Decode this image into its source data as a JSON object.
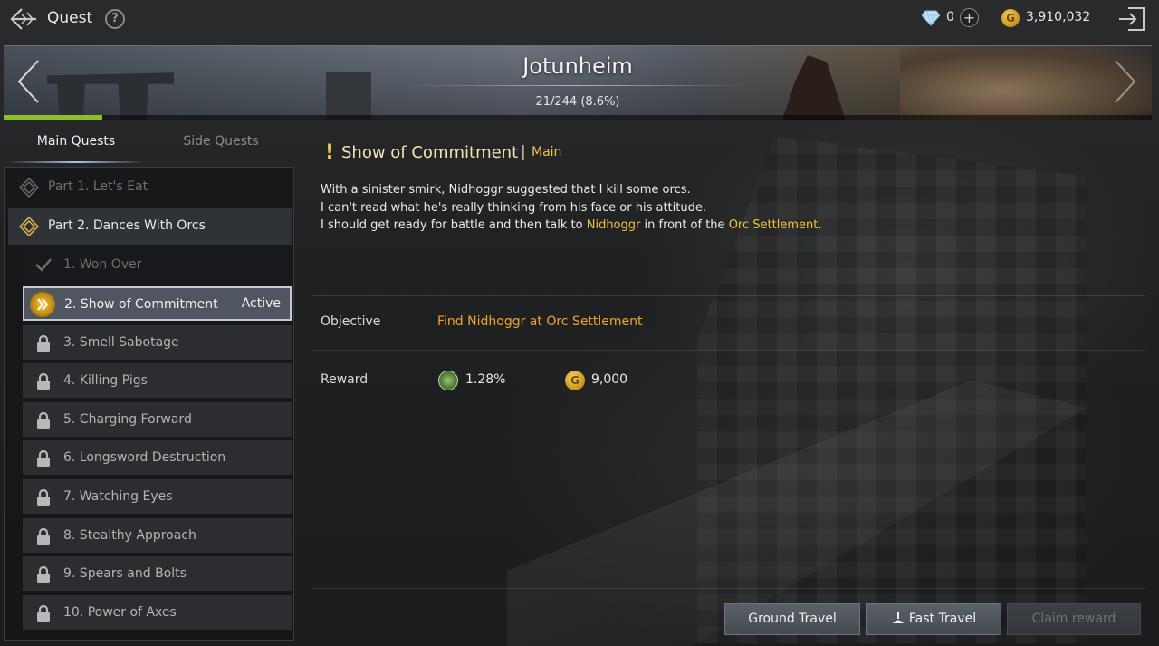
{
  "header": {
    "title": "Quest",
    "gems": "0",
    "gold": "3,910,032",
    "colors": {
      "gold": "#f2c14a",
      "accent_green": "#8bbf2c"
    }
  },
  "banner": {
    "region": "Jotunheim",
    "progress_text": "21/244 (8.6%)",
    "progress_fraction": 0.086
  },
  "tabs": {
    "main": "Main Quests",
    "side": "Side Quests"
  },
  "parts": [
    {
      "label": "Part 1. Let's Eat"
    },
    {
      "label": "Part 2. Dances With Orcs"
    }
  ],
  "quests": [
    {
      "label": "1. Won Over",
      "state": "completed"
    },
    {
      "label": "2. Show of Commitment",
      "state": "active",
      "status": "Active"
    },
    {
      "label": "3. Smell Sabotage",
      "state": "locked"
    },
    {
      "label": "4. Killing Pigs",
      "state": "locked"
    },
    {
      "label": "5. Charging Forward",
      "state": "locked"
    },
    {
      "label": "6. Longsword Destruction",
      "state": "locked"
    },
    {
      "label": "7. Watching Eyes",
      "state": "locked"
    },
    {
      "label": "8. Stealthy Approach",
      "state": "locked"
    },
    {
      "label": "9. Spears and Bolts",
      "state": "locked"
    },
    {
      "label": "10. Power of Axes",
      "state": "locked"
    }
  ],
  "detail": {
    "title": "Show of Commitment",
    "separator": "|",
    "type": "Main",
    "desc_line1": "With a sinister smirk, Nidhoggr suggested that I kill some orcs.",
    "desc_line2": "I can't read what he's really thinking from his face or his attitude.",
    "desc_line3_pre": "I should get ready for battle and then talk to ",
    "desc_line3_name": "Nidhoggr",
    "desc_line3_mid": " in front of the ",
    "desc_line3_place": "Orc Settlement",
    "desc_line3_end": ".",
    "objective_label": "Objective",
    "objective": "Find Nidhoggr at Orc Settlement",
    "reward_label": "Reward",
    "reward_exp": "1.28%",
    "reward_gold": "9,000"
  },
  "buttons": {
    "ground_travel": "Ground Travel",
    "fast_travel": "Fast Travel",
    "claim_reward": "Claim reward"
  },
  "icons": {
    "back": "back-arrow-icon",
    "help": "question-icon",
    "gem": "diamond-icon",
    "gold": "gold-coin-icon",
    "exit": "exit-door-icon",
    "lock": "lock-icon",
    "check": "check-icon",
    "active": "double-chevron-icon",
    "exp": "exp-orb-icon"
  }
}
